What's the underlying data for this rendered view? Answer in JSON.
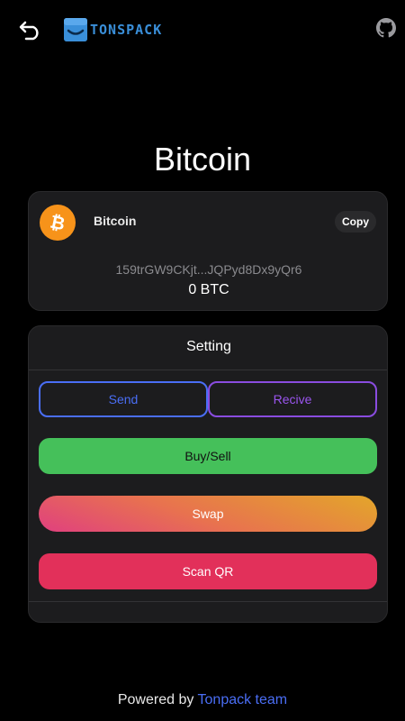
{
  "header": {
    "back_icon": "back-arrow-icon",
    "logo_text": "TONSPACK",
    "github_icon": "github-icon"
  },
  "page": {
    "title": "Bitcoin"
  },
  "wallet": {
    "coin_icon": "bitcoin-icon",
    "coin_name": "Bitcoin",
    "copy_label": "Copy",
    "address": "159trGW9CKjt...JQPyd8Dx9yQr6",
    "balance": "0 BTC"
  },
  "settings": {
    "title": "Setting",
    "send_label": "Send",
    "recive_label": "Recive",
    "buy_sell_label": "Buy/Sell",
    "swap_label": "Swap",
    "scan_label": "Scan QR"
  },
  "footer": {
    "prefix": "Powered by ",
    "link_text": "Tonpack team"
  },
  "colors": {
    "background": "#000000",
    "card": "#1c1c1e",
    "send": "#4a6ef5",
    "recive": "#8a4ce0",
    "buy_sell": "#45c05a",
    "scan": "#e2305a",
    "bitcoin": "#f7931a"
  }
}
